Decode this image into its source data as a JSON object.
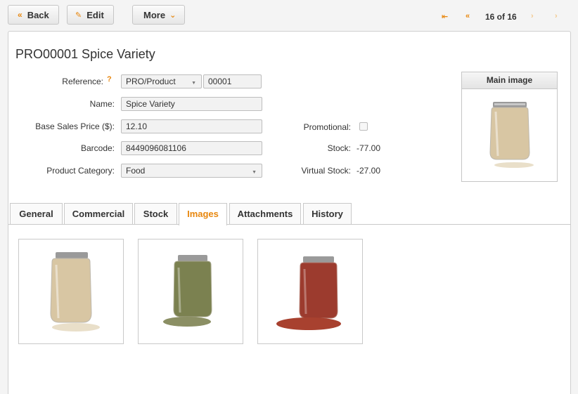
{
  "toolbar": {
    "back_label": "Back",
    "edit_label": "Edit",
    "more_label": "More",
    "pager": "16 of 16"
  },
  "record": {
    "title": "PRO00001 Spice Variety",
    "fields": {
      "reference_label": "Reference:",
      "reference_help": "?",
      "reference_prefix": "PRO/Product",
      "reference_number": "00001",
      "name_label": "Name:",
      "name_value": "Spice Variety",
      "price_label": "Base Sales Price ($):",
      "price_value": "12.10",
      "barcode_label": "Barcode:",
      "barcode_value": "8449096081106",
      "category_label": "Product Category:",
      "category_value": "Food",
      "promotional_label": "Promotional:",
      "promotional_checked": false,
      "stock_label": "Stock:",
      "stock_value": "-77.00",
      "virtual_stock_label": "Virtual Stock:",
      "virtual_stock_value": "-27.00"
    },
    "main_image_label": "Main image"
  },
  "tabs": [
    {
      "label": "General",
      "active": false
    },
    {
      "label": "Commercial",
      "active": false
    },
    {
      "label": "Stock",
      "active": false
    },
    {
      "label": "Images",
      "active": true
    },
    {
      "label": "Attachments",
      "active": false
    },
    {
      "label": "History",
      "active": false
    }
  ],
  "gallery": [
    {
      "content": "beans-jar",
      "jar_color": "#d8c6a3",
      "spill_color": "#e9dfc9"
    },
    {
      "content": "herbs-jar",
      "jar_color": "#7b8150",
      "spill_color": "#8b8f64"
    },
    {
      "content": "chili-jar",
      "jar_color": "#9c3b2e",
      "spill_color": "#a8412f"
    }
  ],
  "colors": {
    "accent": "#e8870e"
  }
}
